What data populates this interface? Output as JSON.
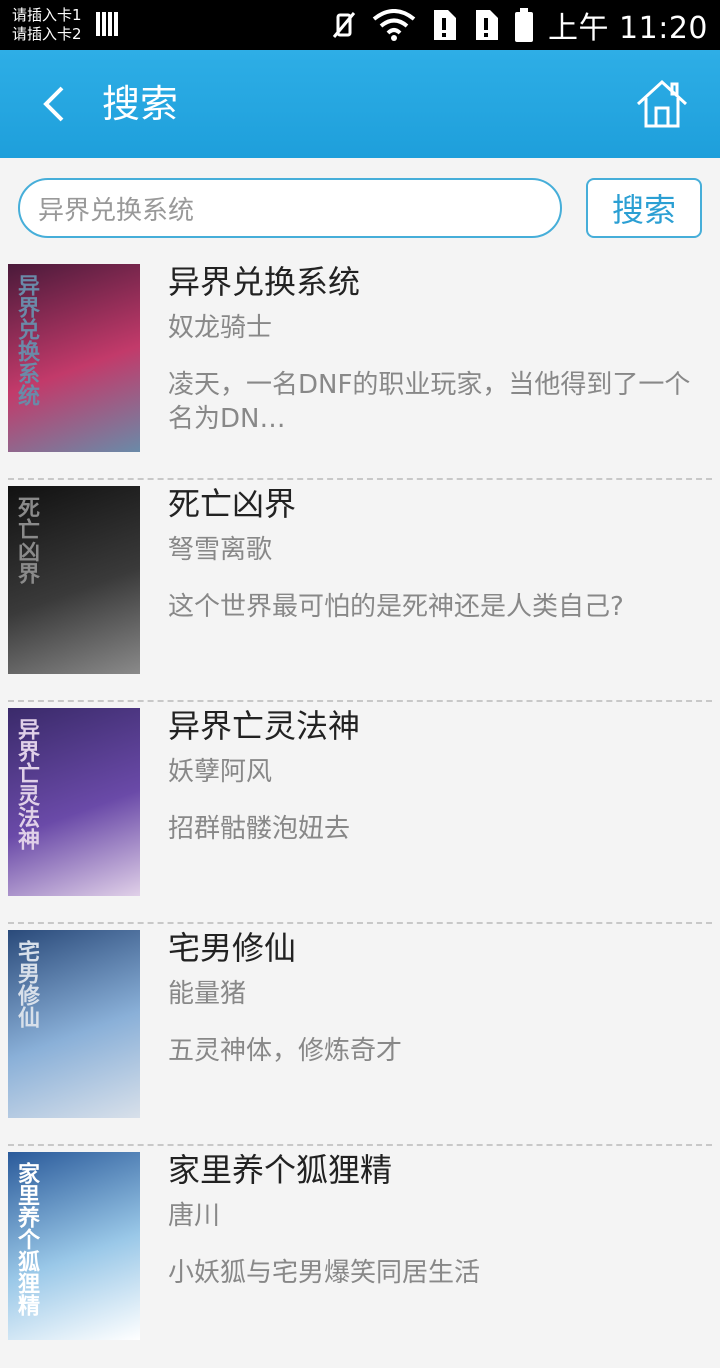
{
  "status_bar": {
    "sim1": "请插入卡1",
    "sim2": "请插入卡2",
    "time": "上午 11:20"
  },
  "app_bar": {
    "title": "搜索"
  },
  "search": {
    "value": "异界兑换系统",
    "button_label": "搜索"
  },
  "results": [
    {
      "title": "异界兑换系统",
      "author": "奴龙骑士",
      "description": "凌天，一名DNF的职业玩家，当他得到了一个名为DN…",
      "cover_text": "异界兑换系统",
      "cover_colors": [
        "#4a1a3a",
        "#c23a6a",
        "#6a8aa8"
      ]
    },
    {
      "title": "死亡凶界",
      "author": "弩雪离歌",
      "description": "这个世界最可怕的是死神还是人类自己?",
      "cover_text": "死亡凶界",
      "cover_colors": [
        "#111111",
        "#3a3a3a",
        "#8a8a8a"
      ]
    },
    {
      "title": "异界亡灵法神",
      "author": "妖孽阿风",
      "description": "招群骷髅泡妞去",
      "cover_text": "异界亡灵法神",
      "cover_colors": [
        "#3a2a6a",
        "#6a4aa8",
        "#e0d0e8"
      ]
    },
    {
      "title": "宅男修仙",
      "author": "能量猪",
      "description": "五灵神体，修炼奇才",
      "cover_text": "宅男修仙",
      "cover_colors": [
        "#2a4a7a",
        "#8ab0d8",
        "#d8e0ea"
      ]
    },
    {
      "title": "家里养个狐狸精",
      "author": "唐川",
      "description": "小妖狐与宅男爆笑同居生活",
      "cover_text": "家里养个狐狸精",
      "cover_colors": [
        "#2a5a9a",
        "#9ac8e8",
        "#ffffff"
      ]
    }
  ]
}
